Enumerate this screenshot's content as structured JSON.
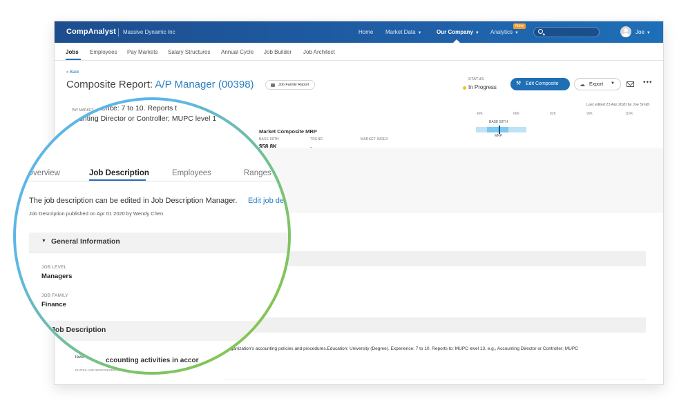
{
  "topbar": {
    "brand": "CompAnalyst",
    "company": "Massive Dynamic Inc",
    "nav": [
      {
        "label": "Home",
        "has_caret": false
      },
      {
        "label": "Market Data",
        "has_caret": true
      },
      {
        "label": "Our Company",
        "has_caret": true
      },
      {
        "label": "Analytics",
        "has_caret": true
      }
    ],
    "new_badge": "New",
    "user": "Joe"
  },
  "subnav": {
    "items": [
      "Jobs",
      "Employees",
      "Pay Markets",
      "Salary Structures",
      "Annual Cycle",
      "Job Builder",
      "Job Architect"
    ]
  },
  "header": {
    "back": "« Back",
    "title_prefix": "Composite Report: ",
    "title_role": "A/P Manager (00398)",
    "job_family_chip": "Job Family Report",
    "status_label": "STATUS",
    "status_value": "In Progress",
    "edit_button": "Edit Composite",
    "export_button": "Export",
    "last_edited": "Last edited 23 Apr 2020 by Joe Smith"
  },
  "market": {
    "pay_market_label": "PAY MARKET",
    "composite_title": "Market Composite MRP",
    "col_base": "BASE 50TH",
    "col_trend": "TREND",
    "col_index": "MARKET INDEX",
    "base_value": "$58.8K",
    "trend_value": "-",
    "scale_ticks": [
      "49K",
      "66K",
      "82K",
      "99K",
      "116K"
    ],
    "bar_label": "BASE 50TH",
    "mrp_label": "MRP"
  },
  "background_text": {
    "jd_line1": "organization's accounting policies and procedures.Education: University (Degree). Experience: 7 to 10. Reports to: MUPC level 13, e.g., Accounting Director or Controller; MUPC",
    "jd_line2": "level",
    "duties_label": "DUTIES AND RESPONSIBILITIES"
  },
  "lens": {
    "fragment_top1": "e). Experience: 7 to 10. Reports t",
    "fragment_top2": "counting Director or Controller; MUPC level 1",
    "tabs": [
      "Overview",
      "Job Description",
      "Employees",
      "Ranges"
    ],
    "edit_note": "The job description can be edited in Job Description Manager.",
    "edit_link": "Edit job de",
    "published": "Job Description published on Apr 01 2020 by Wendy Chen",
    "general_info_title": "General Information",
    "fields": [
      {
        "label": "JOB LEVEL",
        "value": "Managers"
      },
      {
        "label": "JOB FAMILY",
        "value": "Finance"
      }
    ],
    "jd_section_title": "Job Description",
    "bottom_fragment": "ccounting activities in accor"
  }
}
